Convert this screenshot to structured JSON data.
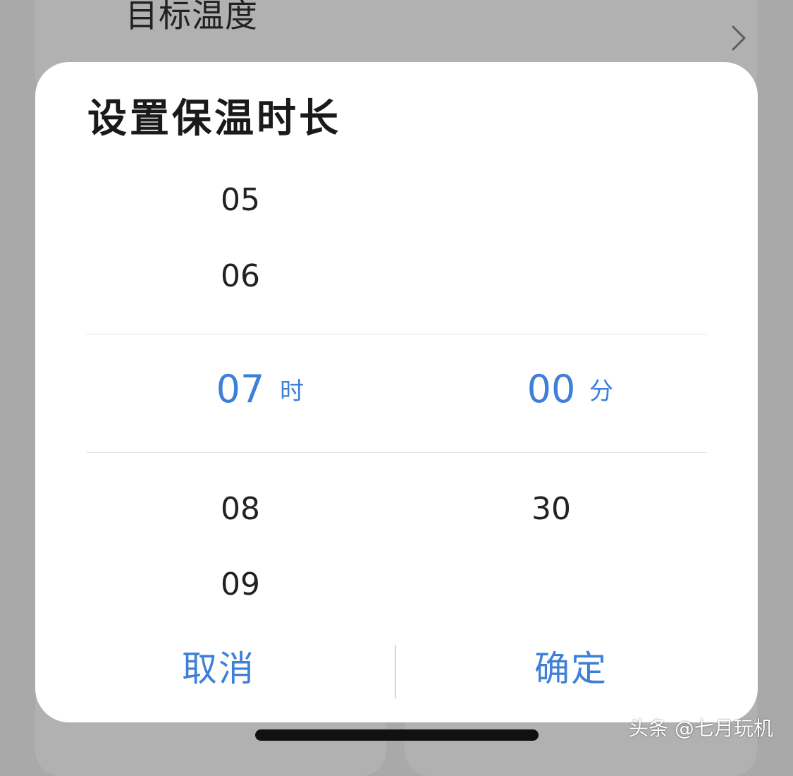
{
  "background": {
    "section_title": "目标温度"
  },
  "dialog": {
    "title": "设置保温时长",
    "hours": {
      "above": [
        "05",
        "06"
      ],
      "selected": "07",
      "below": [
        "08",
        "09"
      ],
      "unit": "时"
    },
    "minutes": {
      "above": [],
      "selected": "00",
      "below": [
        "30"
      ],
      "unit": "分"
    },
    "cancel_label": "取消",
    "confirm_label": "确定"
  },
  "watermark": "头条 @七月玩机",
  "colors": {
    "accent": "#3e7fd8",
    "overlay": "#a9a9a9",
    "dialog_bg": "#ffffff"
  }
}
